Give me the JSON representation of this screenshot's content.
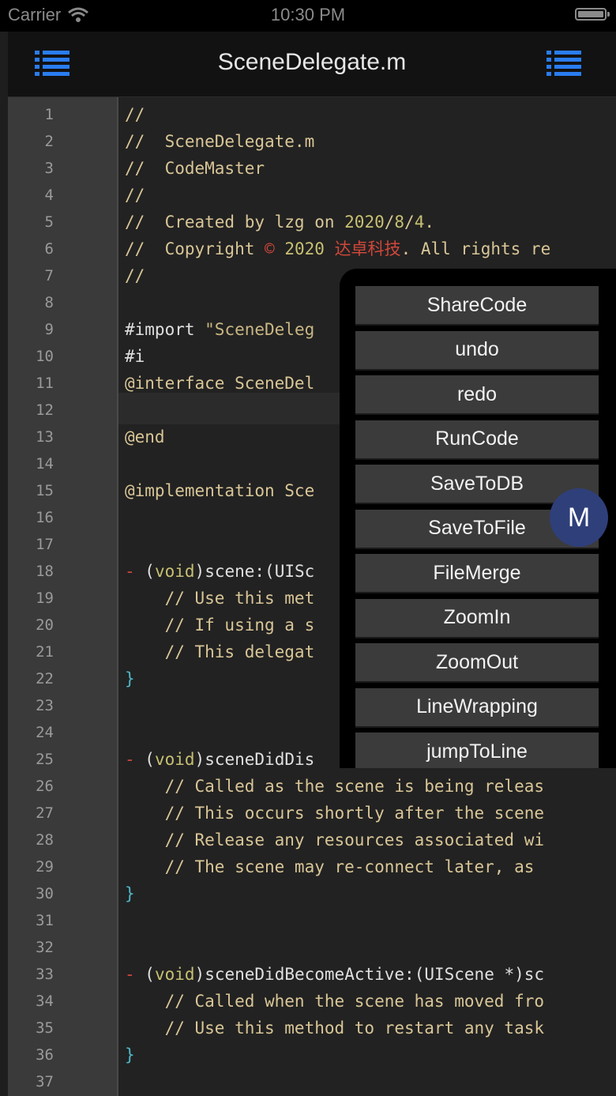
{
  "status_bar": {
    "carrier": "Carrier",
    "time": "10:30 PM"
  },
  "nav": {
    "title": "SceneDelegate.m",
    "accent": "#2a7df0"
  },
  "editor": {
    "line_numbers": [
      "1",
      "2",
      "3",
      "4",
      "5",
      "6",
      "7",
      "8",
      "9",
      "10",
      "11",
      "12",
      "13",
      "14",
      "15",
      "16",
      "17",
      "18",
      "19",
      "20",
      "21",
      "22",
      "23",
      "24",
      "25",
      "26",
      "27",
      "28",
      "29",
      "30",
      "31",
      "32",
      "33",
      "34",
      "35",
      "36",
      "37"
    ],
    "lines": [
      [
        {
          "t": "//",
          "c": "c-comment"
        }
      ],
      [
        {
          "t": "//  SceneDelegate.m",
          "c": "c-comment"
        }
      ],
      [
        {
          "t": "//  CodeMaster",
          "c": "c-comment"
        }
      ],
      [
        {
          "t": "//",
          "c": "c-comment"
        }
      ],
      [
        {
          "t": "//  Created by lzg on ",
          "c": "c-comment"
        },
        {
          "t": "2020",
          "c": "c-green"
        },
        {
          "t": "/",
          "c": "c-comment"
        },
        {
          "t": "8",
          "c": "c-green"
        },
        {
          "t": "/",
          "c": "c-comment"
        },
        {
          "t": "4",
          "c": "c-green"
        },
        {
          "t": ".",
          "c": "c-comment"
        }
      ],
      [
        {
          "t": "//  Copyright ",
          "c": "c-comment"
        },
        {
          "t": "©",
          "c": "c-red"
        },
        {
          "t": " ",
          "c": "c-comment"
        },
        {
          "t": "2020",
          "c": "c-green"
        },
        {
          "t": " ",
          "c": "c-comment"
        },
        {
          "t": "达卓科技",
          "c": "c-red"
        },
        {
          "t": ". All rights re",
          "c": "c-comment"
        }
      ],
      [
        {
          "t": "//",
          "c": "c-comment"
        }
      ],
      [],
      [
        {
          "t": "#import ",
          "c": "c-white"
        },
        {
          "t": "\"SceneDeleg",
          "c": "c-str"
        }
      ],
      [
        {
          "t": "#i",
          "c": "c-white"
        }
      ],
      [
        {
          "t": "@interface SceneDel",
          "c": "c-comment"
        }
      ],
      [],
      [
        {
          "t": "@end",
          "c": "c-comment"
        }
      ],
      [],
      [
        {
          "t": "@implementation Sce",
          "c": "c-comment"
        }
      ],
      [],
      [],
      [
        {
          "t": "- ",
          "c": "c-red"
        },
        {
          "t": "(",
          "c": "c-white"
        },
        {
          "t": "void",
          "c": "c-green"
        },
        {
          "t": ")",
          "c": "c-white"
        },
        {
          "t": "scene:",
          "c": "c-white"
        },
        {
          "t": "(UISc",
          "c": "c-white"
        }
      ],
      [
        {
          "t": "    // Use this met",
          "c": "c-comment"
        }
      ],
      [
        {
          "t": "    // If using a s",
          "c": "c-comment"
        }
      ],
      [
        {
          "t": "    // This delegat",
          "c": "c-comment"
        }
      ],
      [
        {
          "t": "}",
          "c": "c-cyan"
        }
      ],
      [],
      [],
      [
        {
          "t": "- ",
          "c": "c-red"
        },
        {
          "t": "(",
          "c": "c-white"
        },
        {
          "t": "void",
          "c": "c-green"
        },
        {
          "t": ")",
          "c": "c-white"
        },
        {
          "t": "sceneDidDis",
          "c": "c-white"
        }
      ],
      [
        {
          "t": "    // Called as the scene is being releas",
          "c": "c-comment"
        }
      ],
      [
        {
          "t": "    // This occurs shortly after the scene",
          "c": "c-comment"
        }
      ],
      [
        {
          "t": "    // Release any resources associated wi",
          "c": "c-comment"
        }
      ],
      [
        {
          "t": "    // The scene may re-connect later, as ",
          "c": "c-comment"
        }
      ],
      [
        {
          "t": "}",
          "c": "c-cyan"
        }
      ],
      [],
      [],
      [
        {
          "t": "- ",
          "c": "c-red"
        },
        {
          "t": "(",
          "c": "c-white"
        },
        {
          "t": "void",
          "c": "c-green"
        },
        {
          "t": ")",
          "c": "c-white"
        },
        {
          "t": "sceneDidBecomeActive:(UIScene *)sc",
          "c": "c-white"
        }
      ],
      [
        {
          "t": "    // Called when the scene has moved fro",
          "c": "c-comment"
        }
      ],
      [
        {
          "t": "    // Use this method to restart any task",
          "c": "c-comment"
        }
      ],
      [
        {
          "t": "}",
          "c": "c-cyan"
        }
      ],
      []
    ]
  },
  "menu": {
    "items": [
      "ShareCode",
      "undo",
      "redo",
      "RunCode",
      "SaveToDB",
      "SaveToFile",
      "FileMerge",
      "ZoomIn",
      "ZoomOut",
      "LineWrapping",
      "jumpToLine"
    ]
  },
  "floating_button": {
    "label": "M"
  }
}
